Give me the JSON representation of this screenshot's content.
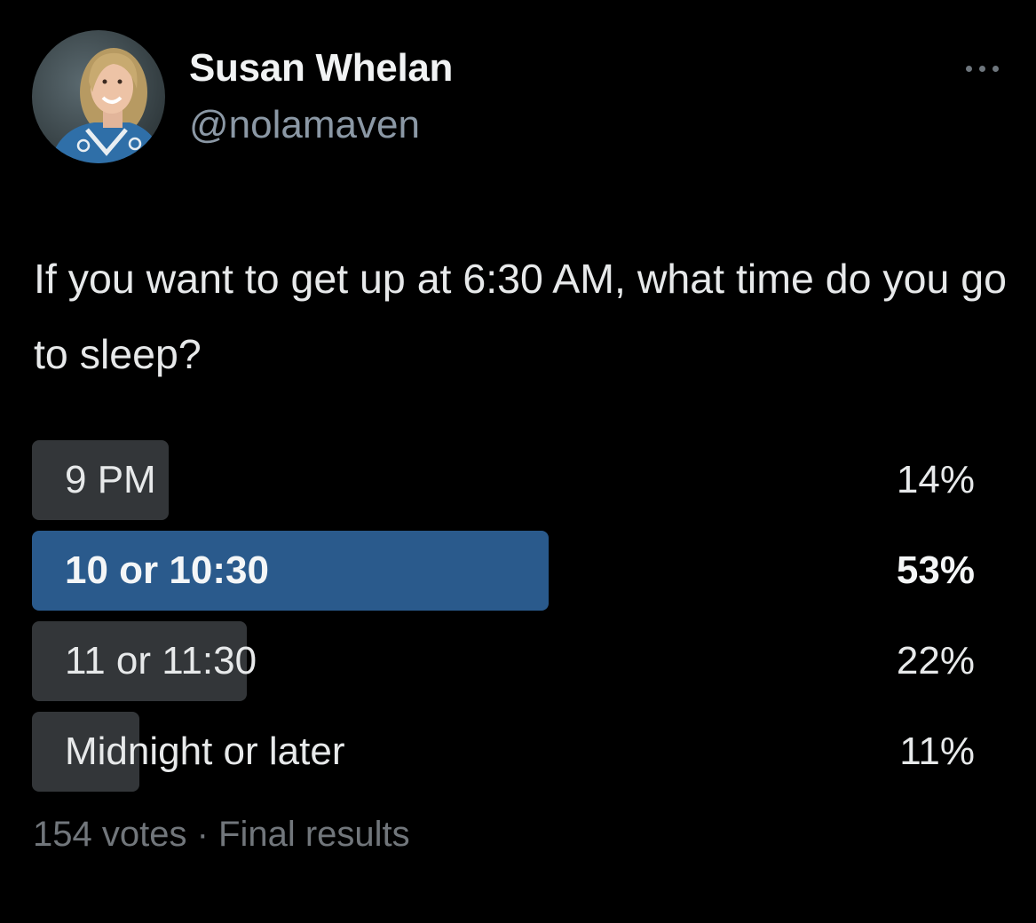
{
  "author": {
    "name": "Susan Whelan",
    "handle": "@nolamaven",
    "avatar_icon": "profile-photo"
  },
  "more_icon": "ellipsis-icon",
  "question": "If you want to get up at 6:30 AM, what time do you go to sleep?",
  "poll": {
    "options": [
      {
        "label": "9 PM",
        "percent_text": "14%",
        "percent": 14,
        "winner": false
      },
      {
        "label": "10 or 10:30",
        "percent_text": "53%",
        "percent": 53,
        "winner": true
      },
      {
        "label": "11 or 11:30",
        "percent_text": "22%",
        "percent": 22,
        "winner": false
      },
      {
        "label": "Midnight or later",
        "percent_text": "11%",
        "percent": 11,
        "winner": false
      }
    ],
    "votes": "154 votes",
    "separator": "·",
    "status": "Final results"
  },
  "colors": {
    "background": "#000000",
    "bar": "#333639",
    "winner_bar": "#2a5a8c",
    "secondary_text": "#71767b"
  }
}
